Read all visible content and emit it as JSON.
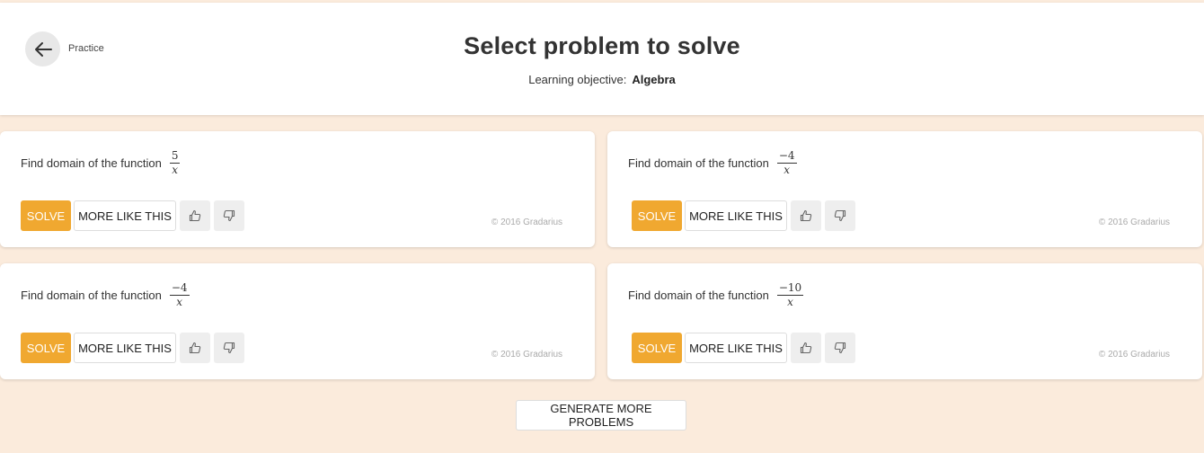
{
  "header": {
    "back_label": "Practice",
    "title": "Select problem to solve",
    "objective_label": "Learning objective:",
    "objective_value": "Algebra"
  },
  "colors": {
    "background": "#fbebdc",
    "accent": "#f0a830"
  },
  "icons": {
    "back": "arrow-left-icon",
    "upvote": "thumbs-up-icon",
    "downvote": "thumbs-down-icon"
  },
  "problems": [
    {
      "prompt": "Find domain of the function",
      "numerator": "5",
      "denominator": "x",
      "solve_label": "SOLVE",
      "more_label": "MORE LIKE THIS",
      "copyright": "© 2016 Gradarius"
    },
    {
      "prompt": "Find domain of the function",
      "numerator": "−4",
      "denominator": "x",
      "solve_label": "SOLVE",
      "more_label": "MORE LIKE THIS",
      "copyright": "© 2016 Gradarius"
    },
    {
      "prompt": "Find domain of the function",
      "numerator": "−4",
      "denominator": "x",
      "solve_label": "SOLVE",
      "more_label": "MORE LIKE THIS",
      "copyright": "© 2016 Gradarius"
    },
    {
      "prompt": "Find domain of the function",
      "numerator": "−10",
      "denominator": "x",
      "solve_label": "SOLVE",
      "more_label": "MORE LIKE THIS",
      "copyright": "© 2016 Gradarius"
    }
  ],
  "footer": {
    "generate_label": "GENERATE MORE PROBLEMS"
  }
}
